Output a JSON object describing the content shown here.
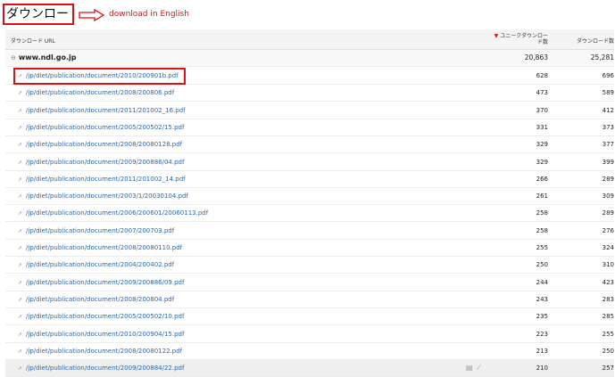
{
  "header": {
    "title": "ダウンロード数",
    "annotation": "download in English"
  },
  "columns": {
    "url": "ダウンロード URL",
    "unique_line1": "ユニークダウンロー",
    "unique_line2": "ド数",
    "downloads": "ダウンロード数"
  },
  "group": {
    "domain": "www.ndl.go.jp",
    "toggle": "⊖",
    "unique": "20,863",
    "downloads": "25,281"
  },
  "rows": [
    {
      "url": "/jp/diet/publication/document/2010/200901b.pdf",
      "unique": "628",
      "downloads": "696"
    },
    {
      "url": "/jp/diet/publication/document/2008/200806.pdf",
      "unique": "473",
      "downloads": "589"
    },
    {
      "url": "/jp/diet/publication/document/2011/201002_16.pdf",
      "unique": "370",
      "downloads": "412"
    },
    {
      "url": "/jp/diet/publication/document/2005/200502/15.pdf",
      "unique": "331",
      "downloads": "373"
    },
    {
      "url": "/jp/diet/publication/document/2008/20080128.pdf",
      "unique": "329",
      "downloads": "377"
    },
    {
      "url": "/jp/diet/publication/document/2009/200886/04.pdf",
      "unique": "329",
      "downloads": "399"
    },
    {
      "url": "/jp/diet/publication/document/2011/201002_14.pdf",
      "unique": "266",
      "downloads": "289"
    },
    {
      "url": "/jp/diet/publication/document/2003/1/20030104.pdf",
      "unique": "261",
      "downloads": "309"
    },
    {
      "url": "/jp/diet/publication/document/2006/200601/20060113.pdf",
      "unique": "258",
      "downloads": "289"
    },
    {
      "url": "/jp/diet/publication/document/2007/200703.pdf",
      "unique": "258",
      "downloads": "276"
    },
    {
      "url": "/jp/diet/publication/document/2008/20080110.pdf",
      "unique": "255",
      "downloads": "324"
    },
    {
      "url": "/jp/diet/publication/document/2004/200402.pdf",
      "unique": "250",
      "downloads": "310"
    },
    {
      "url": "/jp/diet/publication/document/2009/200886/09.pdf",
      "unique": "244",
      "downloads": "423"
    },
    {
      "url": "/jp/diet/publication/document/2008/200804.pdf",
      "unique": "243",
      "downloads": "283"
    },
    {
      "url": "/jp/diet/publication/document/2005/200502/10.pdf",
      "unique": "235",
      "downloads": "285"
    },
    {
      "url": "/jp/diet/publication/document/2010/200904/15.pdf",
      "unique": "223",
      "downloads": "255"
    },
    {
      "url": "/jp/diet/publication/document/2008/20080122.pdf",
      "unique": "213",
      "downloads": "250"
    },
    {
      "url": "/jp/diet/publication/document/2009/200884/22.pdf",
      "unique": "210",
      "downloads": "257"
    }
  ],
  "icons": {
    "external_link": "external-link-icon",
    "row_info": "row-info-icon",
    "row_chart": "row-chart-icon"
  },
  "colors": {
    "annotation": "#e01010",
    "link": "#2a66b0",
    "sort_indicator": "#e01010"
  }
}
